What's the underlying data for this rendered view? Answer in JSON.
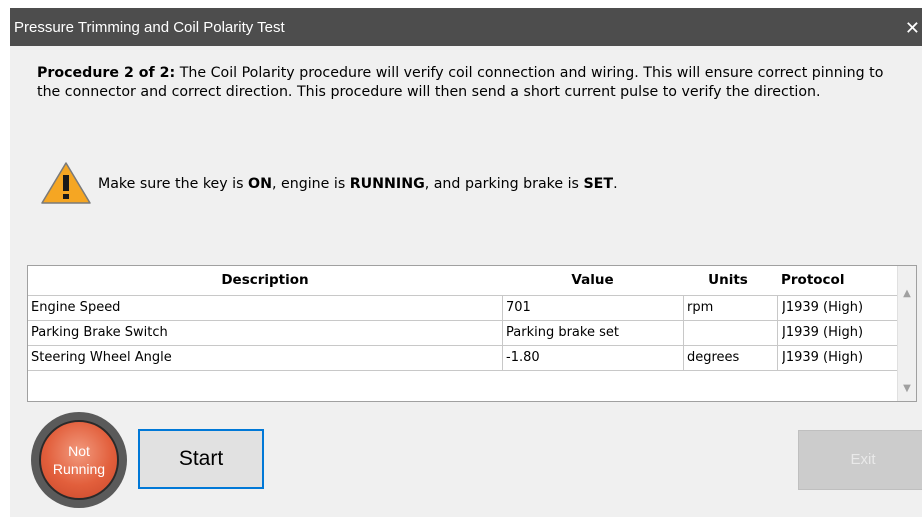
{
  "window": {
    "title": "Pressure Trimming and Coil Polarity Test",
    "close_label": "✕"
  },
  "procedure": {
    "heading": "Procedure 2 of 2:",
    "text": " The Coil Polarity procedure will verify coil connection and wiring. This will ensure correct pinning to the connector and correct direction. This procedure will then send a short current pulse to verify the direction."
  },
  "warning": {
    "icon": "warning-triangle-icon",
    "part1": "Make sure the key is ",
    "key_state": "ON",
    "part2": ", engine is ",
    "engine_state": "RUNNING",
    "part3": ", and parking brake is ",
    "brake_state": "SET",
    "part4": "."
  },
  "table": {
    "headers": {
      "description": "Description",
      "value": "Value",
      "units": "Units",
      "protocol": "Protocol"
    },
    "rows": [
      {
        "description": "Engine Speed",
        "value": "701",
        "units": "rpm",
        "protocol": "J1939 (High)"
      },
      {
        "description": "Parking Brake Switch",
        "value": "Parking brake set",
        "units": "",
        "protocol": "J1939 (High)"
      },
      {
        "description": "Steering Wheel Angle",
        "value": "-1.80",
        "units": "degrees",
        "protocol": "J1939 (High)"
      }
    ]
  },
  "status": {
    "line1": "Not",
    "line2": "Running",
    "color": "#e25f3c"
  },
  "buttons": {
    "start": "Start",
    "exit": "Exit"
  },
  "colors": {
    "titlebar": "#4d4d4d",
    "accent": "#0078d7",
    "warning": "#f5a623"
  }
}
